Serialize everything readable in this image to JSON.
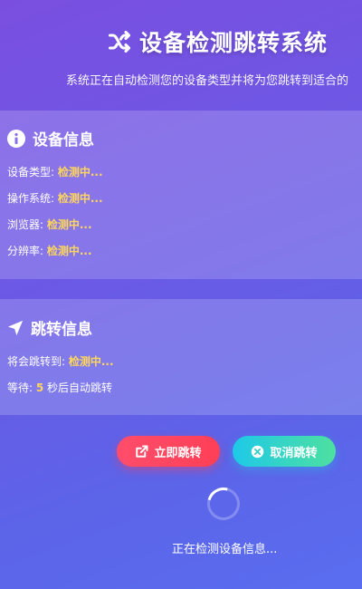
{
  "header": {
    "title": "设备检测跳转系统",
    "subtitle": "系统正在自动检测您的设备类型并将为您跳转到适合的"
  },
  "device_card": {
    "title": "设备信息",
    "icon": "info-icon",
    "rows": [
      {
        "label": "设备类型: ",
        "value": "检测中..."
      },
      {
        "label": "操作系统: ",
        "value": "检测中..."
      },
      {
        "label": "浏览器: ",
        "value": "检测中..."
      },
      {
        "label": "分辨率: ",
        "value": "检测中..."
      }
    ]
  },
  "redirect_card": {
    "title": "跳转信息",
    "icon": "location-arrow-icon",
    "target_label": "将会跳转到: ",
    "target_value": "检测中...",
    "wait_prefix": "等待: ",
    "wait_seconds": "5",
    "wait_suffix": " 秒后自动跳转"
  },
  "buttons": {
    "go_now": "立即跳转",
    "cancel": "取消跳转"
  },
  "status": "正在检测设备信息...",
  "colors": {
    "highlight": "#ffd75a",
    "go_button": "#ff4d6b",
    "cancel_button_start": "#1ec9e8",
    "cancel_button_end": "#4ee0a0",
    "bg_start": "#7a4fe0",
    "bg_end": "#5a6df0"
  }
}
